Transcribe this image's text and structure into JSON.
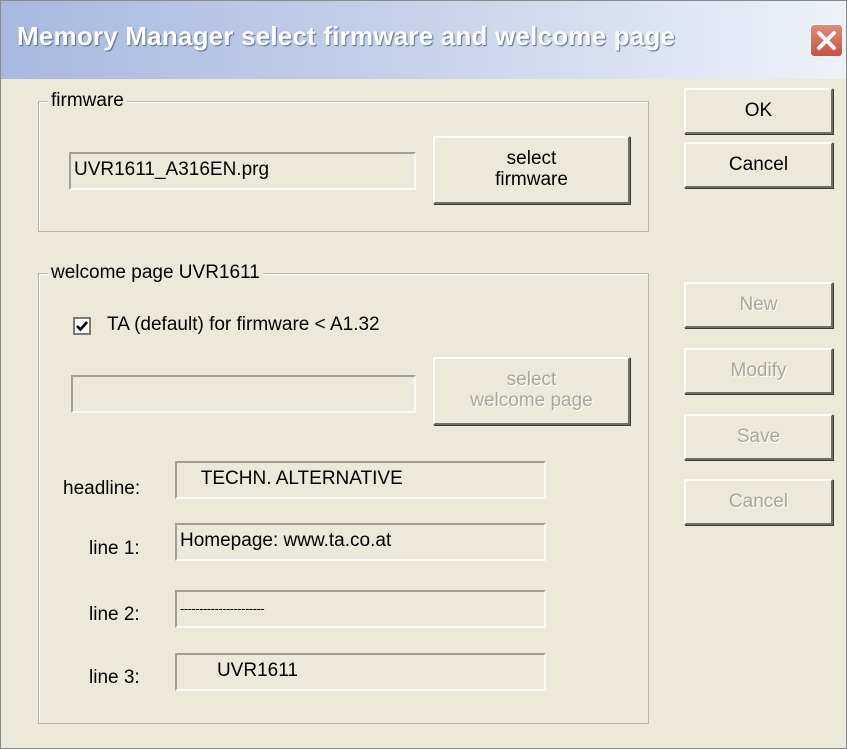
{
  "window": {
    "title": "Memory Manager select firmware and welcome page",
    "close_icon": "close-x-icon"
  },
  "firmware_group": {
    "legend": "firmware",
    "file_value": "UVR1611_A316EN.prg",
    "select_button": {
      "line1": "select",
      "line2": "firmware"
    }
  },
  "welcome_group": {
    "legend": "welcome page UVR1611",
    "checkbox": {
      "label": "TA (default) for firmware < A1.32",
      "checked": true
    },
    "page_value": "",
    "select_button": {
      "line1": "select",
      "line2": "welcome page"
    },
    "fields": {
      "headline": {
        "label": "headline:",
        "value": "    TECHN. ALTERNATIVE"
      },
      "line1": {
        "label": "line 1:",
        "value": "Homepage: www.ta.co.at"
      },
      "line2": {
        "label": "line 2:",
        "value": "----------------------"
      },
      "line3": {
        "label": "line 3:",
        "value": "       UVR1611"
      }
    }
  },
  "side_buttons": {
    "ok": "OK",
    "cancel": "Cancel",
    "new": "New",
    "modify": "Modify",
    "save": "Save",
    "cancel2": "Cancel"
  }
}
